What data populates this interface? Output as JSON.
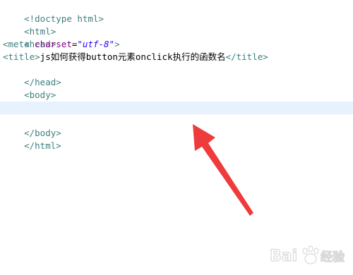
{
  "code": {
    "l1": {
      "doctype": "<!doctype html>"
    },
    "l2": {
      "open": "<html>"
    },
    "l3": {
      "open": "<head>"
    },
    "l4": {
      "tag_open": "<meta",
      "attr": "charset",
      "eq": "=",
      "value": "\"utf-8\"",
      "tag_close": ">"
    },
    "l5": {
      "open": "<title>",
      "text": "js如何获得button元素onclick执行的函数名",
      "close": "</title>"
    },
    "l6": {
      "close": "</head>"
    },
    "l7": {
      "open": "<body>"
    },
    "l8": {
      "text": ""
    },
    "l9": {
      "text": ""
    },
    "l10": {
      "close": "</body>"
    },
    "l11": {
      "close": "</html>"
    }
  },
  "colors": {
    "tag": "#3f7f7f",
    "attribute": "#7f007f",
    "string": "#2a00ff",
    "current_line": "#e8f2fe",
    "arrow": "#ee3b3b"
  },
  "watermark": {
    "text": "Bai经验",
    "icon": "baidu-paw-icon"
  }
}
